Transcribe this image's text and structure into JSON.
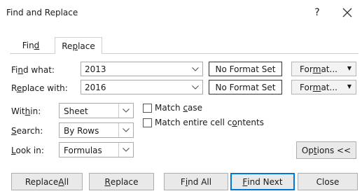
{
  "window": {
    "title": "Find and Replace",
    "help_label": "?",
    "close_label": "×"
  },
  "tabs": [
    {
      "pre": "Fin",
      "acc": "d",
      "post": ""
    },
    {
      "pre": "Re",
      "acc": "p",
      "post": "lace"
    }
  ],
  "find_what": {
    "pre": "Fi",
    "acc": "n",
    "post": "d what:",
    "value": "2013",
    "format_status": "No Format Set",
    "format_pre": "For",
    "format_acc": "m",
    "format_post": "at..."
  },
  "replace_with": {
    "pre": "R",
    "acc": "e",
    "post": "place with:",
    "value": "2016",
    "format_status": "No Format Set",
    "format_pre": "For",
    "format_acc": "m",
    "format_post": "at..."
  },
  "within": {
    "pre": "Wit",
    "acc": "h",
    "post": "in:",
    "value": "Sheet"
  },
  "search": {
    "pre": "",
    "acc": "S",
    "post": "earch:",
    "value": "By Rows"
  },
  "look_in": {
    "pre": "",
    "acc": "L",
    "post": "ook in:",
    "value": "Formulas"
  },
  "match_case": {
    "pre": "Match ",
    "acc": "c",
    "post": "ase",
    "checked": false
  },
  "match_entire": {
    "pre": "Match entire cell c",
    "acc": "o",
    "post": "ntents",
    "checked": false
  },
  "options": {
    "pre": "Op",
    "acc": "t",
    "post": "ions <<"
  },
  "buttons": {
    "replace_all": {
      "pre": "Replace ",
      "acc": "A",
      "post": "ll"
    },
    "replace": {
      "pre": "",
      "acc": "R",
      "post": "eplace"
    },
    "find_all": {
      "pre": "F",
      "acc": "i",
      "post": "nd All"
    },
    "find_next": {
      "pre": "",
      "acc": "F",
      "post": "ind Next"
    },
    "close": {
      "pre": "Close",
      "acc": "",
      "post": ""
    }
  }
}
